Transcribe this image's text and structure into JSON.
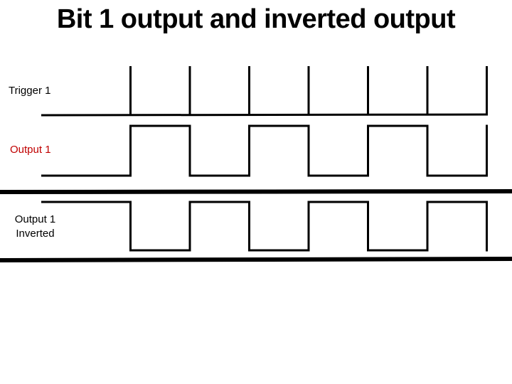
{
  "title": "Bit 1 output and inverted output",
  "signals": [
    {
      "id": "trigger",
      "label": "Trigger 1",
      "color": "#000000",
      "type": "pulse",
      "pulse_count": 7
    },
    {
      "id": "output",
      "label": "Output 1",
      "color": "#c00000",
      "type": "square",
      "initial_level": "low",
      "sequence": [
        0,
        1,
        0,
        1,
        0,
        1,
        0,
        1
      ]
    },
    {
      "id": "inverted",
      "label_line1": "Output 1",
      "label_line2": "Inverted",
      "color": "#000000",
      "type": "square",
      "initial_level": "high",
      "sequence": [
        1,
        0,
        1,
        0,
        1,
        0,
        1,
        0
      ]
    }
  ],
  "trigger_times": [
    1,
    2,
    3,
    4,
    5,
    6,
    7
  ]
}
